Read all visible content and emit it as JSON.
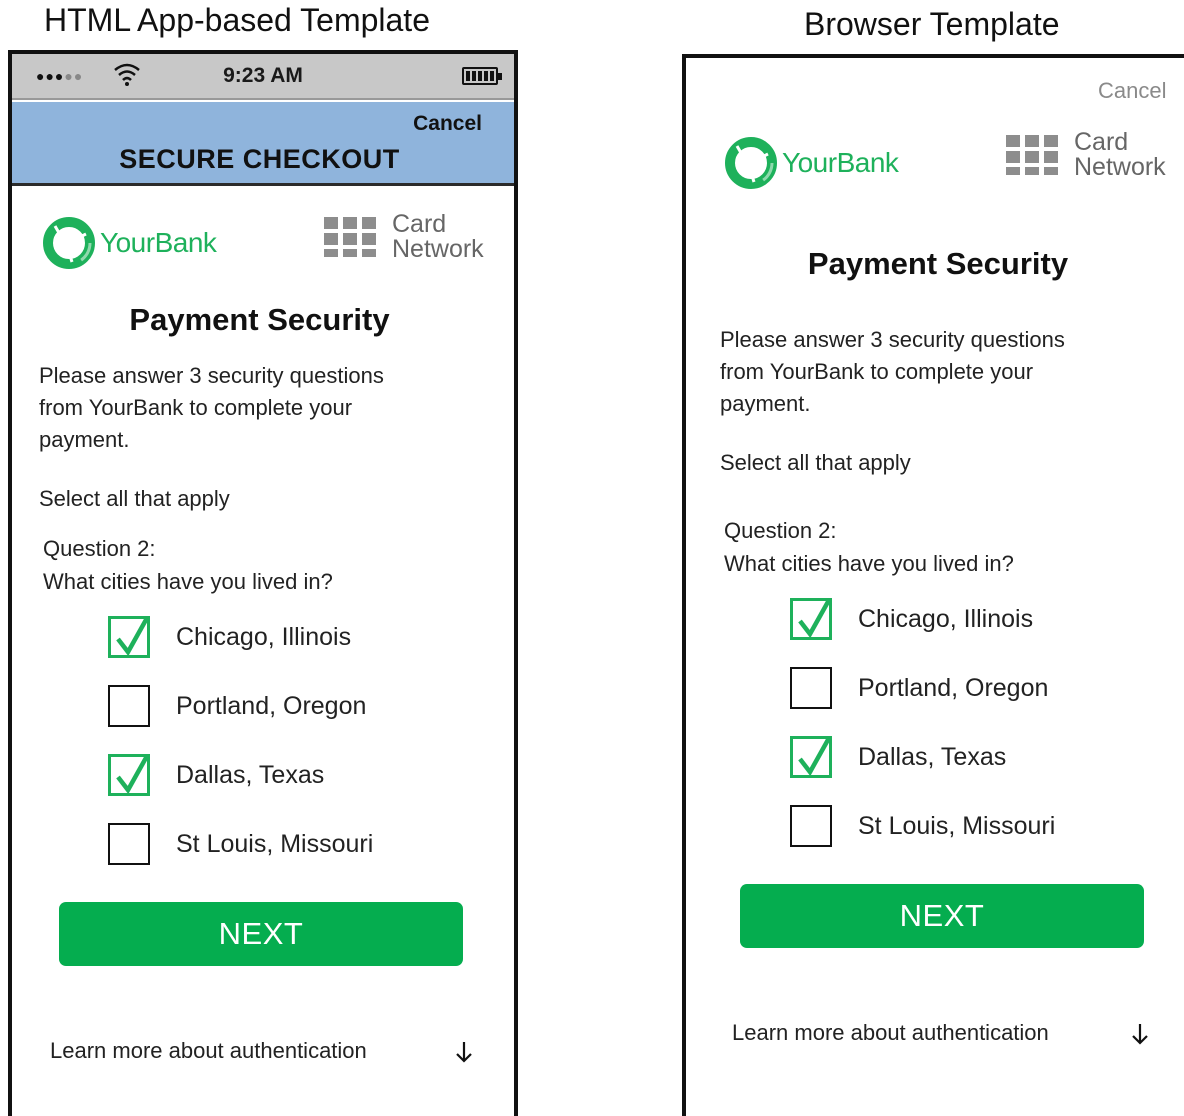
{
  "captions": {
    "left": "HTML App-based Template",
    "right": "Browser Template"
  },
  "phone": {
    "status_bar": {
      "time": "9:23 AM",
      "signal_icon": "signal-dots-icon",
      "wifi_icon": "wifi-icon",
      "battery_icon": "battery-icon"
    },
    "app_bar": {
      "cancel": "Cancel",
      "title": "SECURE CHECKOUT"
    }
  },
  "browser": {
    "cancel": "Cancel"
  },
  "content": {
    "bank_name": "YourBank",
    "card_line1": "Card",
    "card_line2": "Network",
    "heading": "Payment Security",
    "instructions": {
      "line1": "Please answer  3 security questions",
      "line2": "from YourBank to complete your",
      "line3": "payment."
    },
    "select_all": "Select all that apply",
    "question_label": "Question 2:",
    "question_text": "What cities have you lived in?",
    "options": [
      {
        "label": "Chicago, Illinois",
        "checked": true
      },
      {
        "label": "Portland, Oregon",
        "checked": false
      },
      {
        "label": "Dallas, Texas",
        "checked": true
      },
      {
        "label": "St Louis, Missouri",
        "checked": false
      }
    ],
    "next": "NEXT",
    "learn_more": "Learn more about authentication",
    "arrow_icon": "arrow-down-icon"
  },
  "colors": {
    "brand_green": "#1eb15b",
    "button_green": "#05ad4f",
    "app_bar_blue": "#8fb4dc",
    "status_bar_gray": "#c8c8c8"
  }
}
